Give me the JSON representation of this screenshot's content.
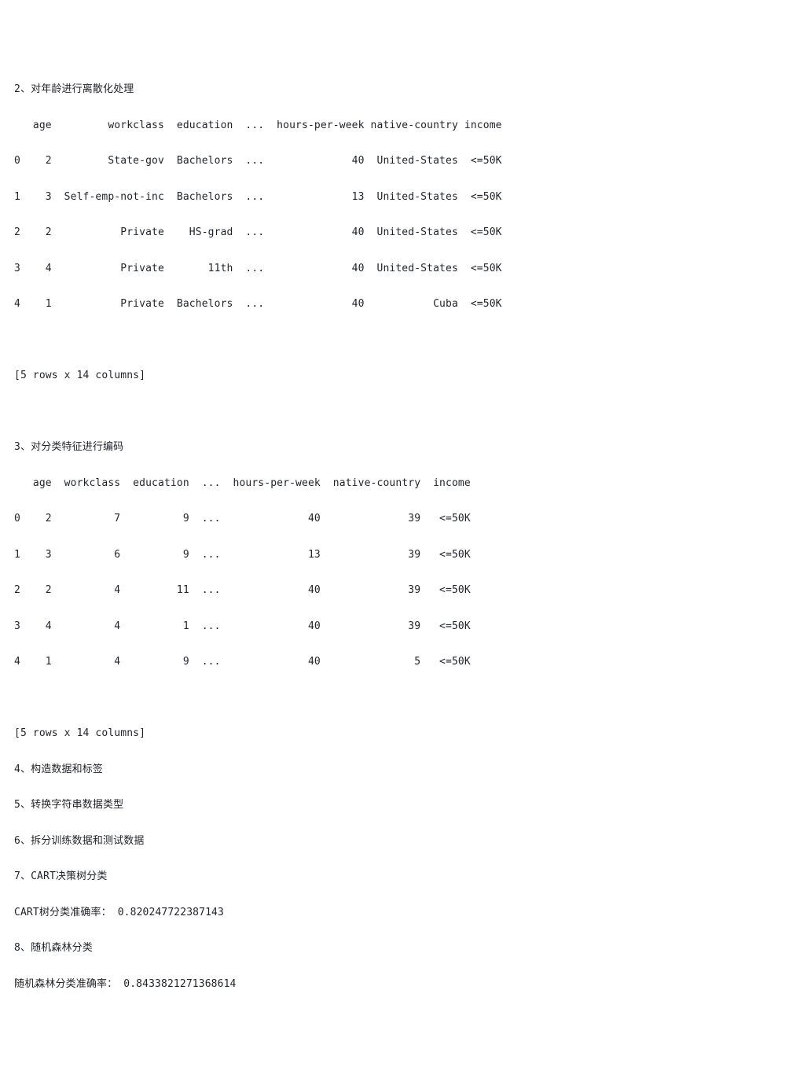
{
  "section2": {
    "title": "2、对年龄进行离散化处理",
    "header": "   age         workclass  education  ...  hours-per-week native-country income",
    "rows": [
      "0    2         State-gov  Bachelors  ...              40  United-States  <=50K",
      "1    3  Self-emp-not-inc  Bachelors  ...              13  United-States  <=50K",
      "2    2           Private    HS-grad  ...              40  United-States  <=50K",
      "3    4           Private       11th  ...              40  United-States  <=50K",
      "4    1           Private  Bachelors  ...              40           Cuba  <=50K"
    ],
    "footer": "[5 rows x 14 columns]"
  },
  "section3": {
    "title": "3、对分类特征进行编码",
    "header": "   age  workclass  education  ...  hours-per-week  native-country  income",
    "rows": [
      "0    2          7          9  ...              40              39   <=50K",
      "1    3          6          9  ...              13              39   <=50K",
      "2    2          4         11  ...              40              39   <=50K",
      "3    4          4          1  ...              40              39   <=50K",
      "4    1          4          9  ...              40               5   <=50K"
    ],
    "footer": "[5 rows x 14 columns]"
  },
  "steps": {
    "s4": "4、构造数据和标签",
    "s5": "5、转换字符串数据类型",
    "s6": "6、拆分训练数据和测试数据",
    "s7": "7、CART决策树分类",
    "cart": "CART树分类准确率： 0.820247722387143",
    "s8": "8、随机森林分类",
    "rf": "随机森林分类准确率： 0.8433821271368614"
  }
}
